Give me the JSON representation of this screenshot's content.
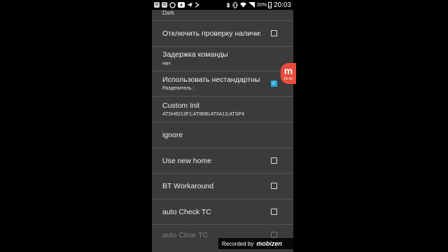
{
  "statusbar": {
    "app_icons": [
      "m",
      "m",
      "whatsapp-icon",
      "youtube-icon",
      "plane-icon",
      "arrow-icon"
    ],
    "battery_percent": "20%",
    "time": "20:03"
  },
  "settings": {
    "previous_value": "Dark",
    "items": [
      {
        "title": "Отключить проверку наличия",
        "checkbox": true,
        "checked": false
      },
      {
        "title": "Задержка команды",
        "subtitle": "Нет"
      },
      {
        "title": "Использовать нестандартный",
        "subtitle": "Разделитель ;",
        "checkbox": true,
        "checked": true
      },
      {
        "title": "Custom Init",
        "subtitle": "ATSH8213F1;ATIB96;ATIIA13;ATSP4"
      },
      {
        "title": "ignore"
      },
      {
        "title": "Use new home",
        "checkbox": true,
        "checked": false
      },
      {
        "title": "BT Workaround",
        "checkbox": true,
        "checked": false
      },
      {
        "title": "auto Check TC",
        "checkbox": true,
        "checked": false
      },
      {
        "title": "auto Clear TC",
        "checkbox": true,
        "checked": false
      }
    ]
  },
  "floating_button": {
    "letter": "m",
    "time": "01:42",
    "color": "#e74c3c"
  },
  "watermark": {
    "prefix": "Recorded by",
    "brand": "mobizen"
  },
  "colors": {
    "accent": "#29a8df",
    "background": "#3b3b3b"
  }
}
